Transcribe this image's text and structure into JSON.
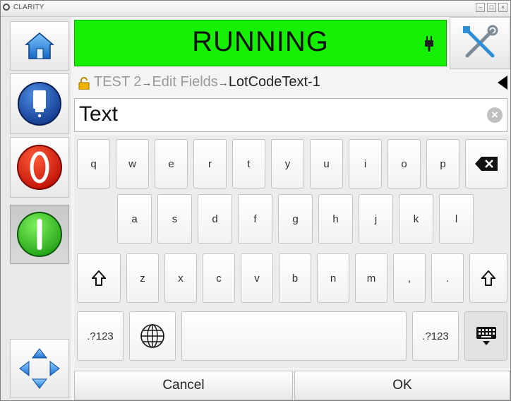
{
  "window": {
    "title": "CLARITY",
    "buttons": [
      "minimize",
      "maximize",
      "close"
    ]
  },
  "status": {
    "text": "RUNNING",
    "color": "#16f005",
    "icon": "plug-icon"
  },
  "left_nav": [
    {
      "name": "home-button",
      "icon": "home-icon"
    },
    {
      "name": "printhead-button",
      "icon": "printhead-icon"
    },
    {
      "name": "stop-button",
      "icon": "stop-icon"
    },
    {
      "name": "start-button",
      "icon": "start-icon",
      "pressed": true
    },
    {
      "name": "nav-button",
      "icon": "direction-pad-icon"
    }
  ],
  "tools": {
    "icon": "tools-icon"
  },
  "breadcrumb": {
    "items": [
      "TEST 2",
      "Edit Fields"
    ],
    "separator": "→",
    "current": "LotCodeText-1",
    "lock_icon": "lock-open-icon",
    "back_icon": "back-arrow-icon"
  },
  "field": {
    "value": "Text",
    "clear_icon": "clear-icon"
  },
  "keyboard": {
    "row1": [
      "q",
      "w",
      "e",
      "r",
      "t",
      "y",
      "u",
      "i",
      "o",
      "p"
    ],
    "row2": [
      "a",
      "s",
      "d",
      "f",
      "g",
      "h",
      "j",
      "k",
      "l"
    ],
    "row3": [
      "z",
      "x",
      "c",
      "v",
      "b",
      "n",
      "m",
      ",",
      "."
    ],
    "symbols_label": ".?123",
    "backspace_icon": "backspace-icon",
    "shift_icon": "shift-icon",
    "globe_icon": "globe-icon",
    "hide_icon": "keyboard-hide-icon"
  },
  "actions": {
    "cancel": "Cancel",
    "ok": "OK"
  }
}
